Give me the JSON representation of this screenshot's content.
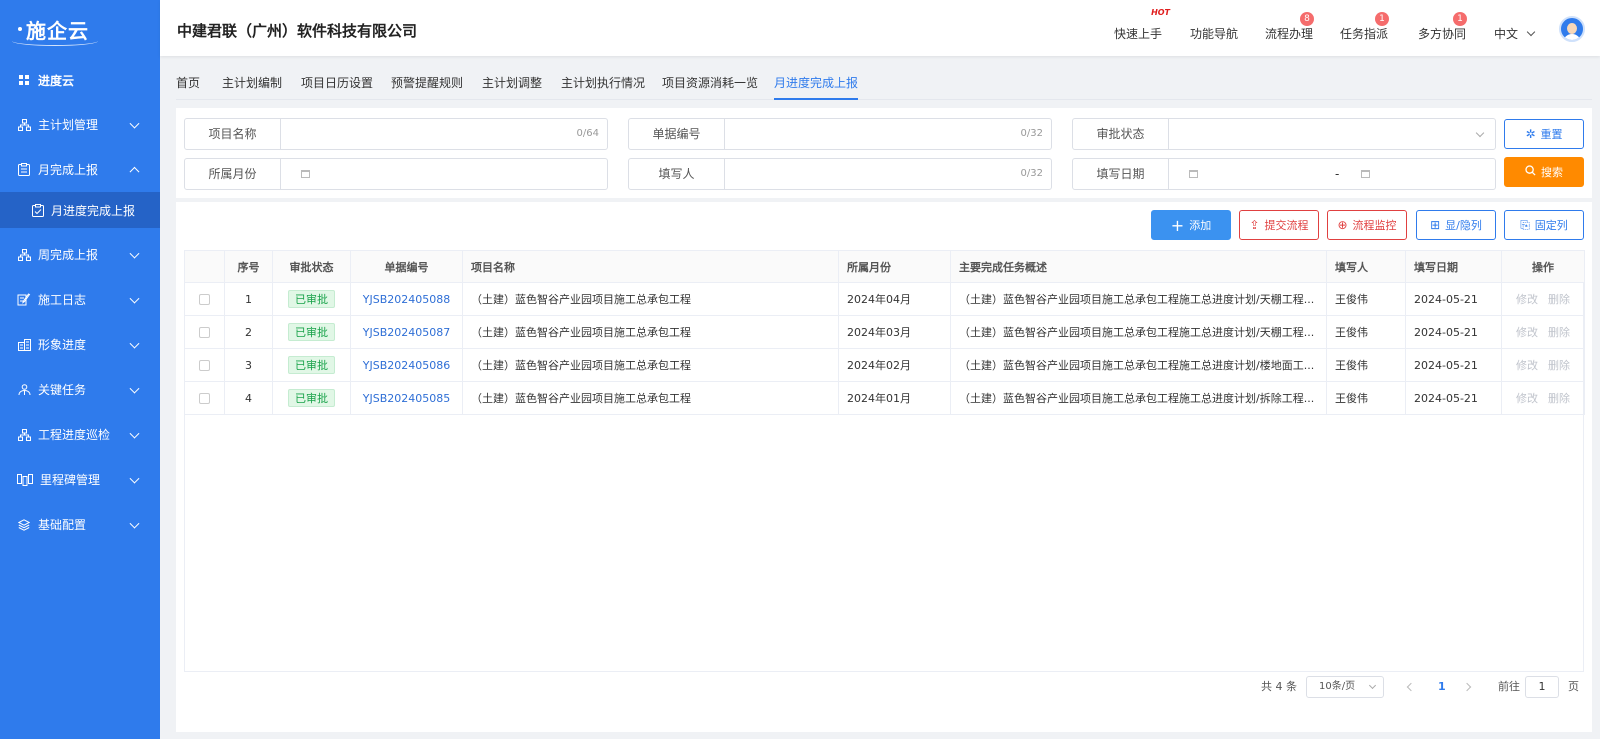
{
  "app": {
    "logo": "施企云",
    "company": "中建君联（广州）软件科技有限公司"
  },
  "header_nav": [
    {
      "label": "快速上手",
      "hot": "HOT"
    },
    {
      "label": "功能导航"
    },
    {
      "label": "流程办理",
      "badge": "8"
    },
    {
      "label": "任务指派",
      "badge": "1"
    },
    {
      "label": "多方协同",
      "badge": "1"
    }
  ],
  "language": "中文",
  "sidebar": {
    "items": [
      {
        "label": "进度云",
        "icon": "grid-icon"
      },
      {
        "label": "主计划管理",
        "icon": "org-tree-icon"
      },
      {
        "label": "月完成上报",
        "icon": "clipboard-icon",
        "expanded": true
      },
      {
        "label": "月进度完成上报",
        "icon": "clipboard-check-icon",
        "sub": true
      },
      {
        "label": "周完成上报",
        "icon": "org-tree-icon"
      },
      {
        "label": "施工日志",
        "icon": "notebook-icon"
      },
      {
        "label": "形象进度",
        "icon": "building-icon"
      },
      {
        "label": "关键任务",
        "icon": "flag-icon"
      },
      {
        "label": "工程进度巡检",
        "icon": "org-tree-icon"
      },
      {
        "label": "里程碑管理",
        "icon": "milestone-icon"
      },
      {
        "label": "基础配置",
        "icon": "layers-icon"
      }
    ]
  },
  "tabs": [
    "首页",
    "主计划编制",
    "项目日历设置",
    "预警提醒规则",
    "主计划调整",
    "主计划执行情况",
    "项目资源消耗一览",
    "月进度完成上报"
  ],
  "active_tab": "月进度完成上报",
  "filters": {
    "project_name": {
      "label": "项目名称",
      "count": "0/64"
    },
    "doc_no": {
      "label": "单据编号",
      "count": "0/32"
    },
    "approval_status": {
      "label": "审批状态"
    },
    "month": {
      "label": "所属月份"
    },
    "filler": {
      "label": "填写人",
      "count": "0/32"
    },
    "fill_date": {
      "label": "填写日期",
      "separator": "-"
    },
    "reset_label": "重置",
    "search_label": "搜索"
  },
  "toolbar": {
    "add": "添加",
    "submit_flow": "提交流程",
    "monitor_flow": "流程监控",
    "show_hide": "显/隐列",
    "fix_col": "固定列"
  },
  "table": {
    "headers": [
      "序号",
      "审批状态",
      "单据编号",
      "项目名称",
      "所属月份",
      "主要完成任务概述",
      "填写人",
      "填写日期",
      "操作"
    ],
    "rows": [
      {
        "no": "1",
        "status": "已审批",
        "doc": "YJSB202405088",
        "project": "（土建）蓝色智谷产业园项目施工总承包工程",
        "month": "2024年04月",
        "summary": "（土建）蓝色智谷产业园项目施工总承包工程施工总进度计划/天棚工程...",
        "filler": "王俊伟",
        "date": "2024-05-21",
        "edit": "修改",
        "del": "删除"
      },
      {
        "no": "2",
        "status": "已审批",
        "doc": "YJSB202405087",
        "project": "（土建）蓝色智谷产业园项目施工总承包工程",
        "month": "2024年03月",
        "summary": "（土建）蓝色智谷产业园项目施工总承包工程施工总进度计划/天棚工程...",
        "filler": "王俊伟",
        "date": "2024-05-21",
        "edit": "修改",
        "del": "删除"
      },
      {
        "no": "3",
        "status": "已审批",
        "doc": "YJSB202405086",
        "project": "（土建）蓝色智谷产业园项目施工总承包工程",
        "month": "2024年02月",
        "summary": "（土建）蓝色智谷产业园项目施工总承包工程施工总进度计划/楼地面工...",
        "filler": "王俊伟",
        "date": "2024-05-21",
        "edit": "修改",
        "del": "删除"
      },
      {
        "no": "4",
        "status": "已审批",
        "doc": "YJSB202405085",
        "project": "（土建）蓝色智谷产业园项目施工总承包工程",
        "month": "2024年01月",
        "summary": "（土建）蓝色智谷产业园项目施工总承包工程施工总进度计划/拆除工程...",
        "filler": "王俊伟",
        "date": "2024-05-21",
        "edit": "修改",
        "del": "删除"
      }
    ]
  },
  "pagination": {
    "total": "共 4 条",
    "page_size": "10条/页",
    "current": "1",
    "goto_prefix": "前往",
    "goto_value": "1",
    "goto_suffix": "页"
  },
  "colors": {
    "sidebar": "#2f7bec",
    "accent": "#2f7bec",
    "search": "#ff8a00",
    "danger": "#e04040",
    "approved": "#19a34a"
  }
}
